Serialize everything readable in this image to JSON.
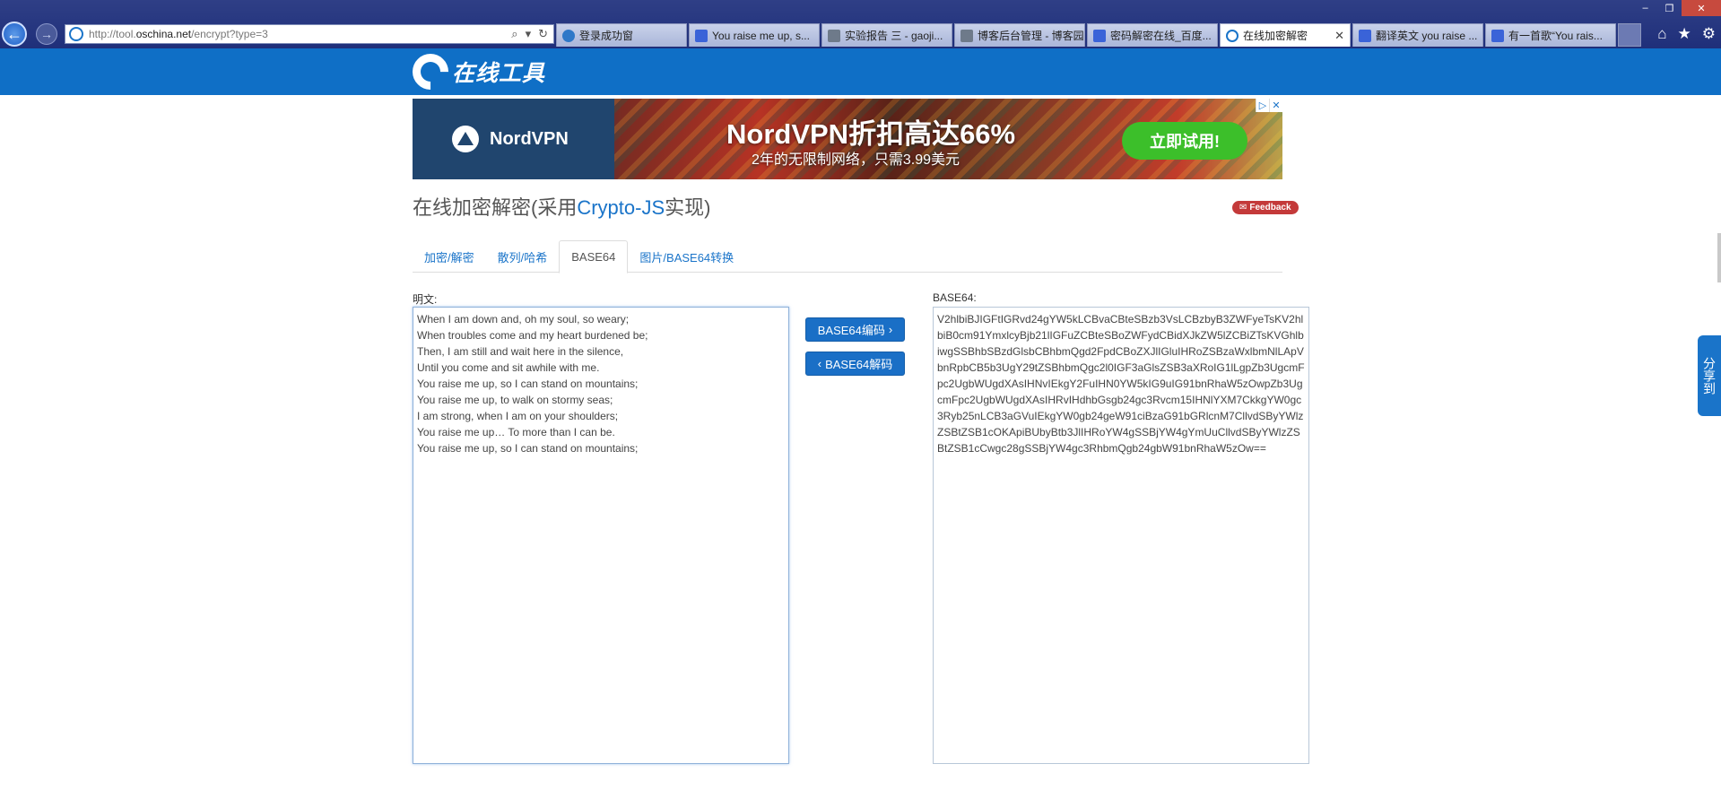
{
  "browser": {
    "address_prefix": "http://tool.",
    "address_domain": "oschina.net",
    "address_path": "/encrypt?type=3",
    "tabs": [
      {
        "label": "登录成功窗",
        "icon": "ie-icon",
        "active": false
      },
      {
        "label": "You raise me up, s...",
        "icon": "baidu-paw-icon",
        "active": false
      },
      {
        "label": "实验报告 三 - gaoji...",
        "icon": "cnblogs-icon",
        "active": false
      },
      {
        "label": "博客后台管理 - 博客园",
        "icon": "cnblogs-icon",
        "active": false
      },
      {
        "label": "密码解密在线_百度...",
        "icon": "baidu-paw-icon",
        "active": false
      },
      {
        "label": "在线加密解密",
        "icon": "oschina-icon",
        "active": true
      },
      {
        "label": "翻译英文 you raise ...",
        "icon": "baidu-paw-icon",
        "active": false
      },
      {
        "label": "有一首歌“You rais...",
        "icon": "baidu-paw-icon",
        "active": false
      }
    ]
  },
  "site": {
    "logo_text": "在线工具"
  },
  "ad": {
    "brand": "NordVPN",
    "headline": "NordVPN折扣高达66%",
    "subline": "2年的无限制网络，只需3.99美元",
    "cta": "立即试用!"
  },
  "page": {
    "title_prefix": "在线加密解密(采用",
    "title_highlight": "Crypto-JS",
    "title_suffix": "实现)",
    "feedback_label": "Feedback",
    "tabs": [
      {
        "label": "加密/解密",
        "active": false
      },
      {
        "label": "散列/哈希",
        "active": false
      },
      {
        "label": "BASE64",
        "active": true
      },
      {
        "label": "图片/BASE64转换",
        "active": false
      }
    ]
  },
  "plaintext": {
    "label": "明文:",
    "lines": [
      "When I am down and, oh my soul, so weary;",
      "When troubles come and my heart burdened be;",
      "Then, I am still and wait here in the silence,",
      "Until you come and sit awhile with me.",
      "You raise me up, so I can stand on mountains;",
      "You raise me up, to walk on stormy seas;",
      "I am strong, when I am on your shoulders;",
      "You raise me up… To more than I can be.",
      "You raise me up, so I can stand on mountains;"
    ]
  },
  "buttons": {
    "encode": "BASE64编码",
    "decode": "BASE64解码"
  },
  "base64": {
    "label": "BASE64:",
    "paragraphs": [
      "V2hlbiBJIGFtIGRvd24gYW5kLCBvaCBteSBzb3VsLCBzbyB3ZWFyeTsKV2hlbiB0cm91YmxlcyBjb21lIGFuZCBteSBoZWFydCBidXJkZW5lZCBiZTsKVGhlbiwgSSBhbSBzdGlsbCBhbmQgd2FpdCBoZXJlIGluIHRoZSBzaWxlbmNlLApVbnRpbCB5b3UgY29tZSBhbmQgc2l0IGF3aGlsZSB3aXRoIG1lLgpZb3UgcmFpc2UgbWUgdXAsIHNvIEkgY2FuIHN0YW5kIG9uIG91bnRhaW5zOwpZb3UgcmFpc2UgbWUgdXAsIHRvIHdhbGsgb24gc3Rvcm15IHNlYXM7CkkgYW0gc3Ryb25nLCB3aGVuIEkgYW0gb24geW91ciBzaG91bGRlcnM7CllvdSByYWlzZSBtZSB1cOKApiBUbyBtb3JlIHRoYW4gSSBjYW4gYmUuCllvdSByYWlzZSBtZSB1cCwgc28gSSBjYW4gc3RhbmQgb24gbW91bnRhaW5zOw=="
    ],
    "display_lines": [
      "V2hlbiBJIGFtIGRvd24gYW5kLCBvaCBteSBzb3VsLCBzbyB3ZWFyeTs",
      "KV2hlbiB0cm91YmxlcyBjb21lIGFuZCBteSBoZWFydCBidXJkZW5lZCB",
      "iZTsKVGhlbiwgSSBhbSBzdGlsbCBhbmQgd2FpdCBoZXJlIGluIHRoZS",
      "BzaWxlbmNlLApVbnRpbCB5b3UgY29tZSBhbmQgc2l0IGF3aGlsZSB3aXRoIG1lLgpZb3UgcmFpc2UgbWUgdXAsIHNvIEkgY2FuIHN0YW5kIG9uIG91bnRhaW5zOwpZb3UgcmFpc2UgbWUgdXAsIHRvIHdhbGsgb24gc3Rvcm15IHNlYXM7CkkgYW0gc3Ryb25nLCB3aGVuIEkgYW0gb24geW91ciBzaG91bGRlcnM7CllvdSByYWlzZSBtZSB1cOKApiBUbyBtb3JlIHRoYW4gSSBjYW4gYmUuCllvdSByYWlzZSBtZSB1cCwgc28gSSBjYW4gc3RhbmQgb24gbW91bnRhaW5zOw=="
    ]
  },
  "share": {
    "label": "分享到"
  }
}
